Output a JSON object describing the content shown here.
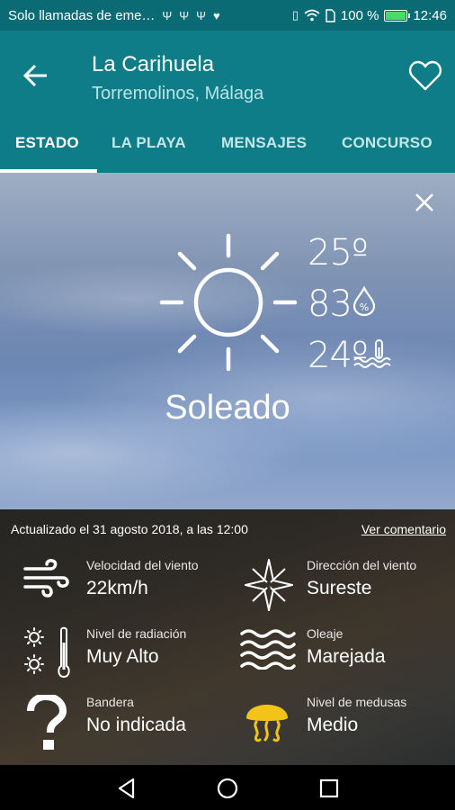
{
  "status_bar": {
    "left_text": "Solo llamadas de eme…",
    "battery_text": "100 %",
    "battery_level": 1.0,
    "time": "12:46",
    "icons": [
      "usb-icon",
      "usb-icon",
      "usb-icon",
      "health-icon",
      "vibrate-icon",
      "wifi-icon",
      "sim-icon"
    ]
  },
  "app_bar": {
    "title": "La Carihuela",
    "subtitle": "Torremolinos, Málaga"
  },
  "tabs": [
    {
      "label": "ESTADO",
      "active": true
    },
    {
      "label": "LA PLAYA",
      "active": false
    },
    {
      "label": "MENSAJES",
      "active": false
    },
    {
      "label": "CONCURSO",
      "active": false
    }
  ],
  "weather": {
    "temperature": "25º",
    "humidity": "83",
    "water_temperature": "24º",
    "condition": "Soleado"
  },
  "info": {
    "updated": "Actualizado el 31 agosto 2018, a las 12:00",
    "comment_link": "Ver comentario",
    "items": [
      {
        "label": "Velocidad del viento",
        "value": "22km/h",
        "icon": "wind-icon"
      },
      {
        "label": "Dirección del viento",
        "value": "Sureste",
        "icon": "compass-rose-icon"
      },
      {
        "label": "Nivel de radiación",
        "value": "Muy Alto",
        "icon": "radiation-level-icon"
      },
      {
        "label": "Oleaje",
        "value": "Marejada",
        "icon": "waves-icon"
      },
      {
        "label": "Bandera",
        "value": "No indicada",
        "icon": "question-mark-icon"
      },
      {
        "label": "Nivel de medusas",
        "value": "Medio",
        "icon": "jellyfish-icon"
      }
    ]
  },
  "colors": {
    "primary": "#0f7d87",
    "status_bar": "#0a6b74",
    "jellyfish_yellow": "#f2c418"
  }
}
